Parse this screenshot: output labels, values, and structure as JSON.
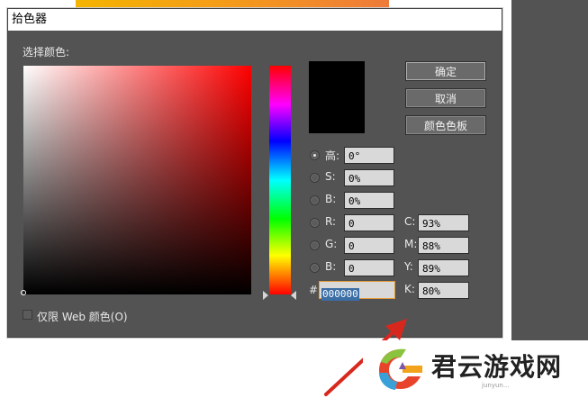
{
  "dialog": {
    "title": "拾色器",
    "select_label": "选择颜色:",
    "buttons": {
      "ok": "确定",
      "cancel": "取消",
      "swatches": "颜色色板"
    },
    "hsb": [
      {
        "label": "高:",
        "value": "0°",
        "checked": true
      },
      {
        "label": "S:",
        "value": "0%",
        "checked": false
      },
      {
        "label": "B:",
        "value": "0%",
        "checked": false
      }
    ],
    "rgb": [
      {
        "label": "R:",
        "value": "0"
      },
      {
        "label": "G:",
        "value": "0"
      },
      {
        "label": "B:",
        "value": "0"
      }
    ],
    "cmyk": [
      {
        "label": "C:",
        "value": "93%"
      },
      {
        "label": "M:",
        "value": "88%"
      },
      {
        "label": "Y:",
        "value": "89%"
      },
      {
        "label": "K:",
        "value": "80%"
      }
    ],
    "hex": {
      "prefix": "#",
      "value": "000000"
    },
    "web_only_label": "仅限 Web 颜色(O)",
    "current_color": "#000000"
  },
  "watermark": {
    "text": "君云游戏网",
    "sub": "junyun..."
  }
}
